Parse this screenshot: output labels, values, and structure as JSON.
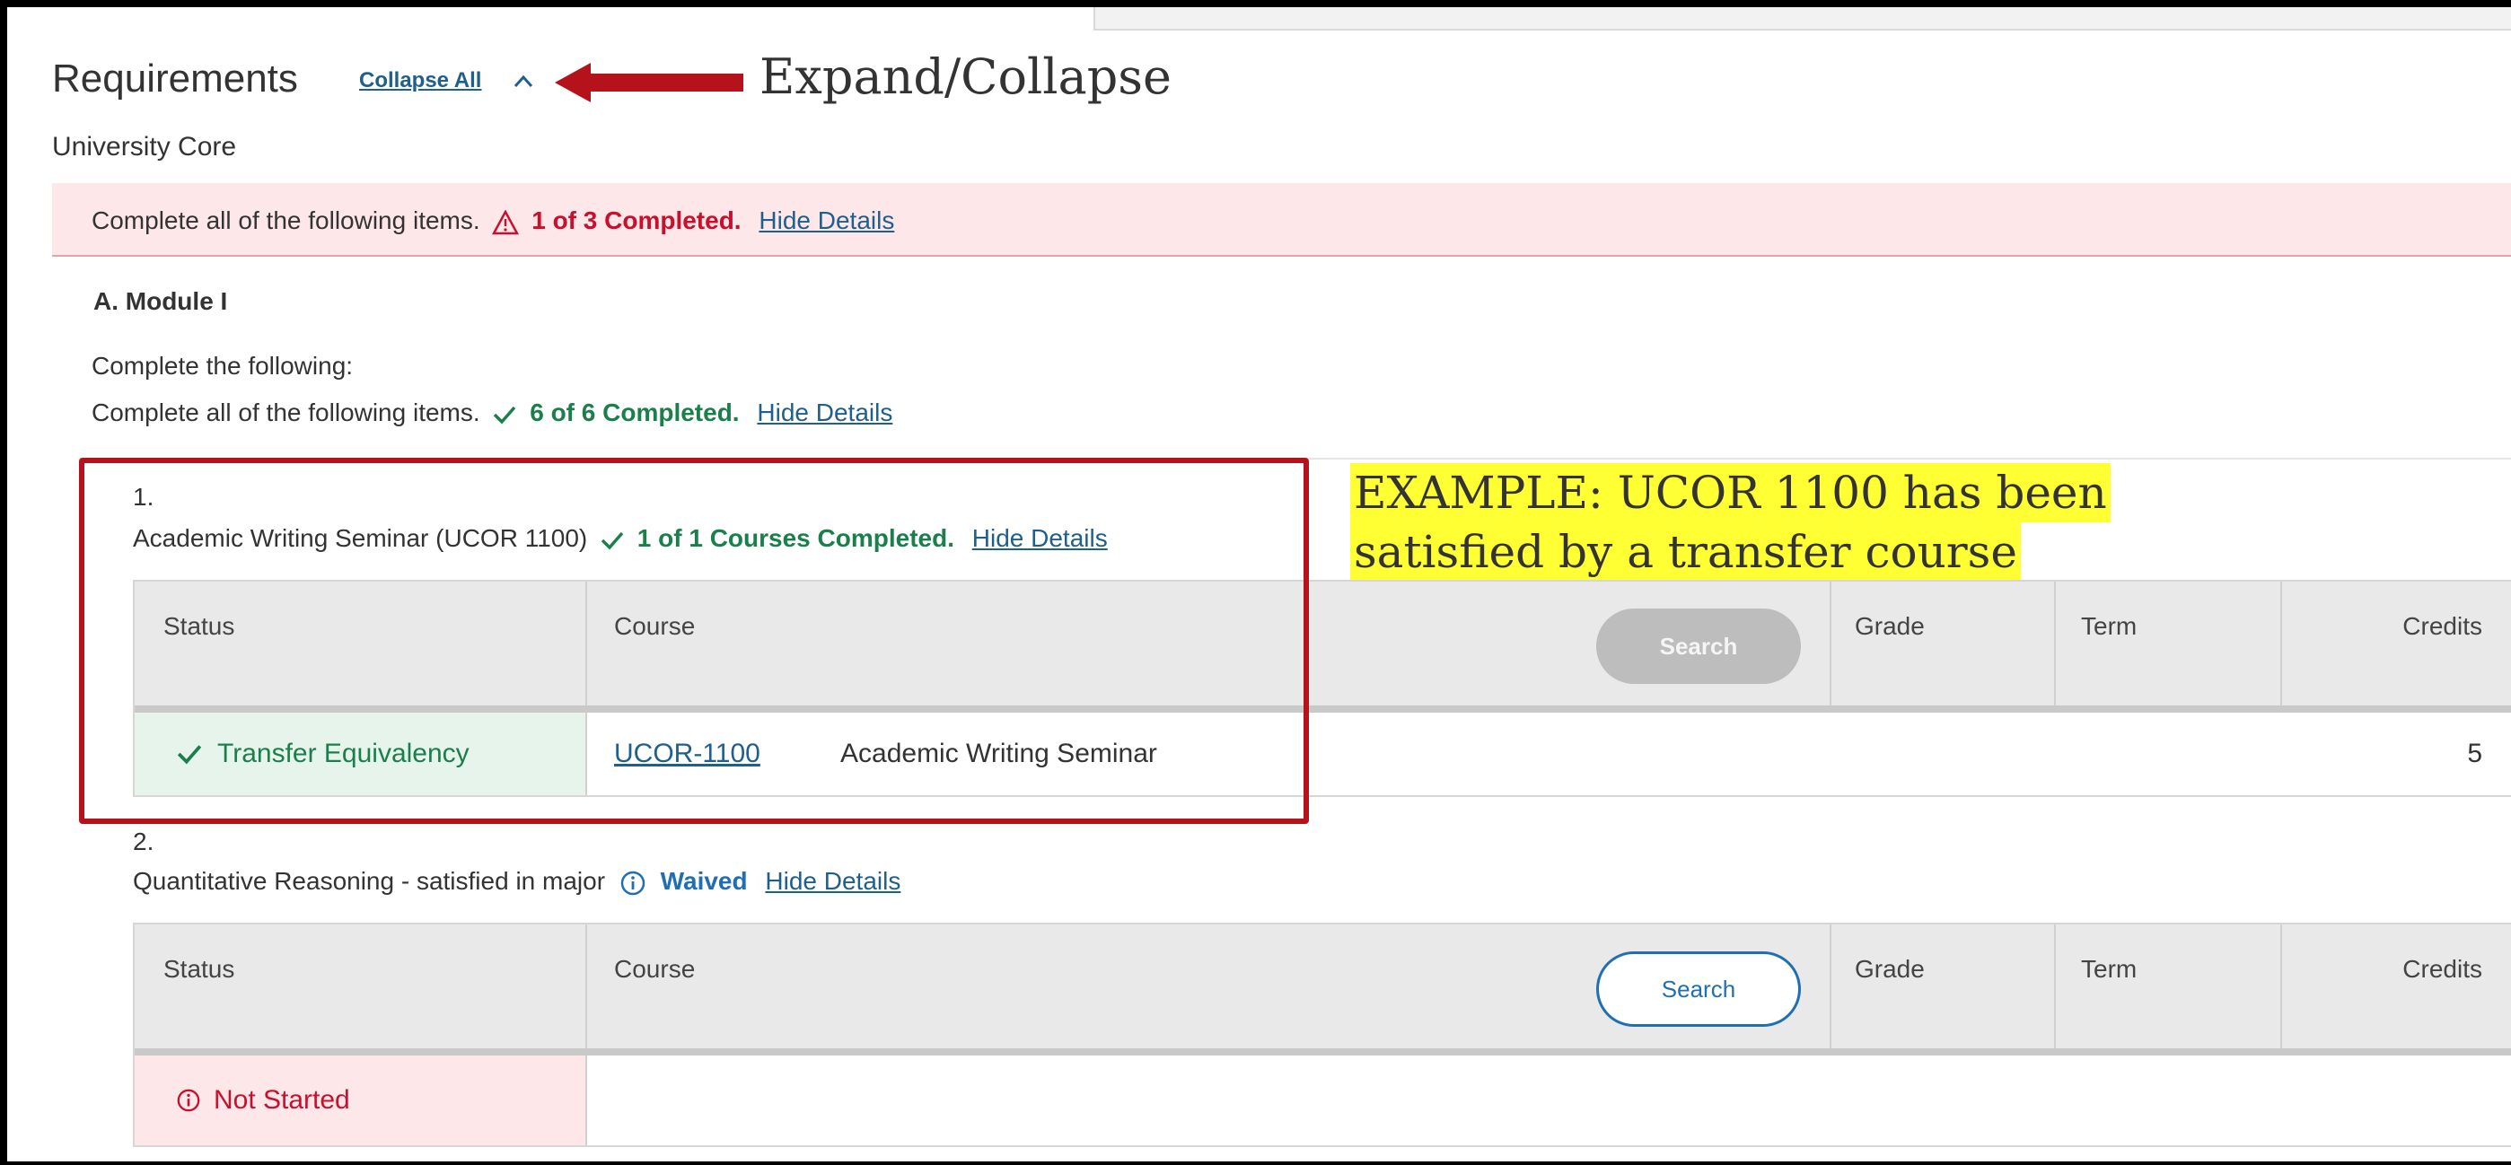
{
  "header": {
    "title": "Requirements",
    "collapse_all": "Collapse All",
    "callout": "Expand/Collapse"
  },
  "section": {
    "name": "University Core",
    "instruction": "Complete all of the following items.",
    "progress": "1 of 3 Completed.",
    "hide_details": "Hide Details"
  },
  "module": {
    "title": "A. Module I",
    "line1": "Complete the following:",
    "instruction": "Complete all of the following items.",
    "progress": "6 of 6 Completed.",
    "hide_details": "Hide Details"
  },
  "example_callout": {
    "line1": "EXAMPLE: UCOR 1100 has been",
    "line2": "satisfied by a transfer course"
  },
  "items": [
    {
      "number": "1.",
      "title": "Academic Writing Seminar (UCOR 1100)",
      "progress": "1 of 1 Courses Completed.",
      "hide_details": "Hide Details",
      "headers": {
        "status": "Status",
        "course": "Course",
        "search": "Search",
        "grade": "Grade",
        "term": "Term",
        "credits": "Credits"
      },
      "row": {
        "status": "Transfer Equivalency",
        "course_code": "UCOR-1100",
        "course_title": "Academic Writing Seminar",
        "credits": "5"
      }
    },
    {
      "number": "2.",
      "title": "Quantitative Reasoning - satisfied in major",
      "progress": "Waived",
      "hide_details": "Hide Details",
      "headers": {
        "status": "Status",
        "course": "Course",
        "search": "Search",
        "grade": "Grade",
        "term": "Term",
        "credits": "Credits"
      },
      "row": {
        "status": "Not Started"
      }
    }
  ],
  "colors": {
    "accent_link": "#1f5f8b",
    "complete_green": "#1a7f4b",
    "error_red": "#c8102e",
    "waived_blue": "#1f6fb2",
    "highlight_yellow": "#ffff33",
    "annotation_red": "#b5121b"
  }
}
